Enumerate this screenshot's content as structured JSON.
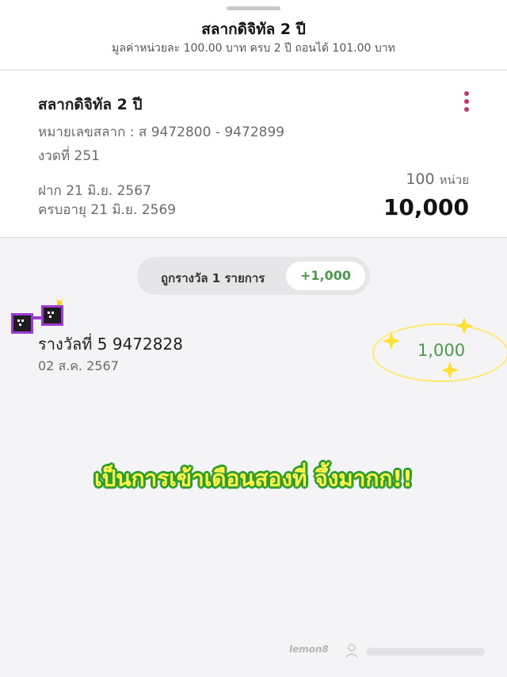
{
  "header": {
    "title": "สลากดิจิทัล 2 ปี",
    "subtitle": "มูลค่าหน่วยละ 100.00 บาท ครบ 2 ปี ถอนได้ 101.00 บาท"
  },
  "card": {
    "title": "สลากดิจิทัล 2 ปี",
    "lottery_numbers": "หมายเลขสลาก : ส 9472800 - 9472899",
    "draw": "งวดที่ 251",
    "deposit_date": "ฝาก 21 มิ.ย. 2567",
    "maturity_date": "ครบอายุ 21 มิ.ย. 2569",
    "units_value": "100",
    "units_label": "หน่วย",
    "amount": "10,000"
  },
  "summary": {
    "label": "ถูกรางวัล 1 รายการ",
    "value": "+1,000"
  },
  "prize": {
    "title": "รางวัลที่ 5  9472828",
    "date": "02 ส.ค. 2567",
    "amount": "1,000"
  },
  "caption": "เป็นการเข้าเดือนสองที่ จึ้งมากก!!",
  "watermark": "lemon8",
  "colors": {
    "accent_green": "#4a9a4a",
    "kebab": "#c23a5f",
    "caption_fill": "#fff24a",
    "caption_outline": "#2f9e2f"
  }
}
